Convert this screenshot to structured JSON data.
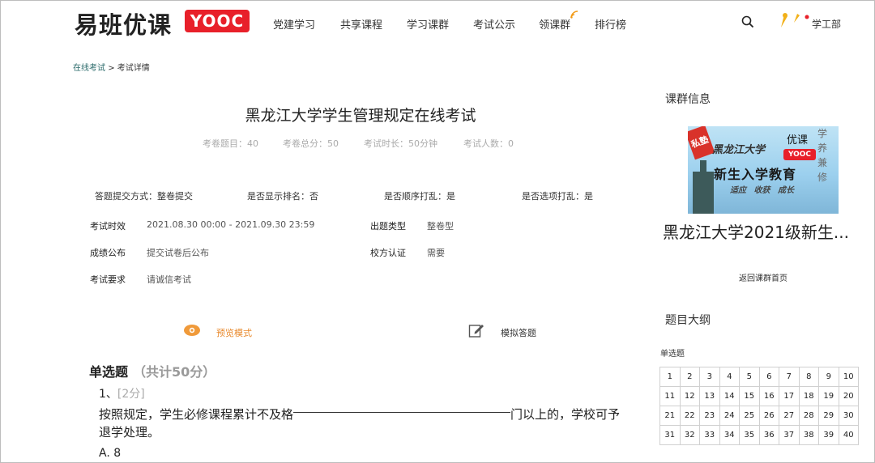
{
  "header": {
    "logo_text": "易班优课",
    "logo_badge": "YOOC",
    "nav": [
      "党建学习",
      "共享课程",
      "学习课群",
      "考试公示",
      "领课群",
      "排行榜"
    ],
    "user": "学工部"
  },
  "breadcrumb": {
    "parent": "在线考试",
    "sep": ">",
    "current": "考试详情"
  },
  "exam": {
    "title": "黑龙江大学学生管理规定在线考试",
    "stats": [
      "考卷题目：40",
      "考卷总分：50",
      "考试时长：50分钟",
      "考试人数：0"
    ],
    "options": [
      "答题提交方式：整卷提交",
      "是否显示排名：否",
      "是否顺序打乱：是",
      "是否选项打乱：是"
    ],
    "details": {
      "time_label": "考试时效",
      "time_value": "2021.08.30 00:00 - 2021.09.30 23:59",
      "type_label": "出题类型",
      "type_value": "整卷型",
      "publish_label": "成绩公布",
      "publish_value": "提交试卷后公布",
      "auth_label": "校方认证",
      "auth_value": "需要",
      "req_label": "考试要求",
      "req_value": "请诚信考试"
    },
    "modes": {
      "preview": "预览模式",
      "simulate": "模拟答题"
    }
  },
  "section": {
    "title": "单选题",
    "points": "（共计50分）"
  },
  "question": {
    "number": "1、",
    "points": "[2分]",
    "text_before": "按照规定，学生必修课程累计不及格",
    "text_after": "门以上的，学校可予退学处理。",
    "option_a": "A. 8"
  },
  "sidebar": {
    "group_title": "课群信息",
    "cover": {
      "seal": "私塾",
      "university": "黑龙江大学",
      "brand": "优课",
      "badge": "YOOC",
      "headline": "新生入学教育",
      "slogan": "适应 收获 成长",
      "calligraphy": "学养兼修"
    },
    "course_name": "黑龙江大学2021级新生...",
    "back_link": "返回课群首页",
    "outline_title": "题目大纲",
    "section_label": "单选题",
    "numbers": [
      [
        "1",
        "2",
        "3",
        "4",
        "5",
        "6",
        "7",
        "8",
        "9",
        "10"
      ],
      [
        "11",
        "12",
        "13",
        "14",
        "15",
        "16",
        "17",
        "18",
        "19",
        "20"
      ],
      [
        "21",
        "22",
        "23",
        "24",
        "25",
        "26",
        "27",
        "28",
        "29",
        "30"
      ],
      [
        "31",
        "32",
        "33",
        "34",
        "35",
        "36",
        "37",
        "38",
        "39",
        "40"
      ]
    ]
  },
  "colors": {
    "brand_red": "#e8202a",
    "preview_orange": "#e8882a",
    "link_teal": "#2a6a6a"
  },
  "icons": {
    "search": "search-icon",
    "user": "user-icon",
    "preview": "eye-icon",
    "simulate": "edit-icon",
    "feed": "wifi-icon"
  }
}
